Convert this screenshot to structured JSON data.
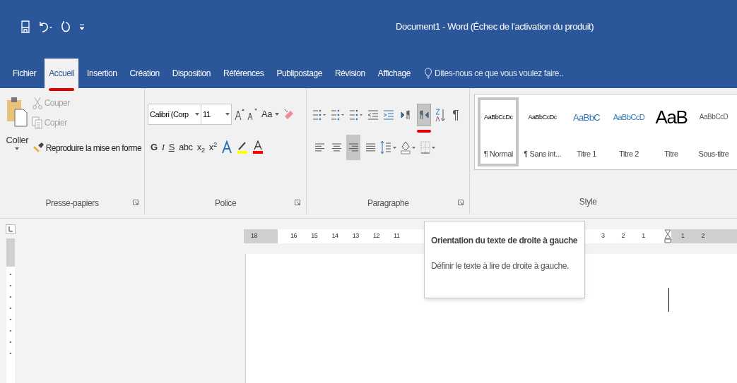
{
  "window": {
    "title": "Document1 - Word (Échec de l'activation du produit)"
  },
  "tabs": [
    {
      "label": "Fichier",
      "selected": false,
      "marked": false
    },
    {
      "label": "Accueil",
      "selected": true,
      "marked": true
    },
    {
      "label": "Insertion",
      "selected": false,
      "marked": false
    },
    {
      "label": "Création",
      "selected": false,
      "marked": false
    },
    {
      "label": "Disposition",
      "selected": false,
      "marked": false
    },
    {
      "label": "Références",
      "selected": false,
      "marked": false
    },
    {
      "label": "Publipostage",
      "selected": false,
      "marked": false
    },
    {
      "label": "Révision",
      "selected": false,
      "marked": false
    },
    {
      "label": "Affichage",
      "selected": false,
      "marked": false
    }
  ],
  "tell_me": {
    "placeholder": "Dites-nous ce que vous voulez faire.."
  },
  "clipboard": {
    "label": "Presse-papiers",
    "paste": "Coller",
    "items": [
      {
        "kind": "cut",
        "label": "Couper",
        "disabled": true
      },
      {
        "kind": "copy",
        "label": "Copier",
        "disabled": true
      },
      {
        "kind": "painter",
        "label": "Reproduire la mise en forme",
        "disabled": false
      }
    ]
  },
  "font": {
    "label": "Police",
    "font_name": "Calibri (Corp",
    "font_size": "11",
    "change_case": "Aa",
    "format_buttons": [
      {
        "kind": "bold",
        "label": "G"
      },
      {
        "kind": "italic",
        "label": "I"
      },
      {
        "kind": "underline",
        "label": "S"
      },
      {
        "kind": "strike",
        "label": "abc"
      },
      {
        "kind": "script",
        "label": "x$_{2}$"
      },
      {
        "kind": "script",
        "label": "x$^{2}$"
      }
    ]
  },
  "paragraph": {
    "label": "Paragraphe",
    "direction": [
      {
        "kind": "ltr",
        "selected": false,
        "marked": false
      },
      {
        "kind": "rtl",
        "selected": true,
        "marked": true
      }
    ],
    "show_marks": "¶",
    "alignment": [
      {
        "kind": "left",
        "selected": false
      },
      {
        "kind": "center",
        "selected": false
      },
      {
        "kind": "right",
        "selected": true
      },
      {
        "kind": "justify",
        "selected": false
      }
    ]
  },
  "styles": {
    "label": "Style",
    "items": [
      {
        "kind": "normal",
        "preview": "AaBbCcDc",
        "name": "¶ Normal",
        "selected": true
      },
      {
        "kind": "normal",
        "preview": "AaBbCcDc",
        "name": "¶ Sans int...",
        "selected": false
      },
      {
        "kind": "heading1",
        "preview": "AaBbC",
        "name": "Titre 1",
        "selected": false
      },
      {
        "kind": "heading2",
        "preview": "AaBbCcD",
        "name": "Titre 2",
        "selected": false
      },
      {
        "kind": "title",
        "preview": "AaB",
        "name": "Titre",
        "selected": false
      },
      {
        "kind": "subtitle",
        "preview": "AaBbCcD",
        "name": "Sous-titre",
        "selected": false
      }
    ]
  },
  "ruler": {
    "left_numbers": [
      "18",
      "16",
      "15",
      "14",
      "13",
      "12",
      "11"
    ],
    "right_numbers": [
      "3",
      "2",
      "1"
    ],
    "after_numbers": [
      "1",
      "2"
    ]
  },
  "tooltip": {
    "title": "Orientation du texte de droite à gauche",
    "description": "Définir le texte à lire de droite à gauche."
  }
}
